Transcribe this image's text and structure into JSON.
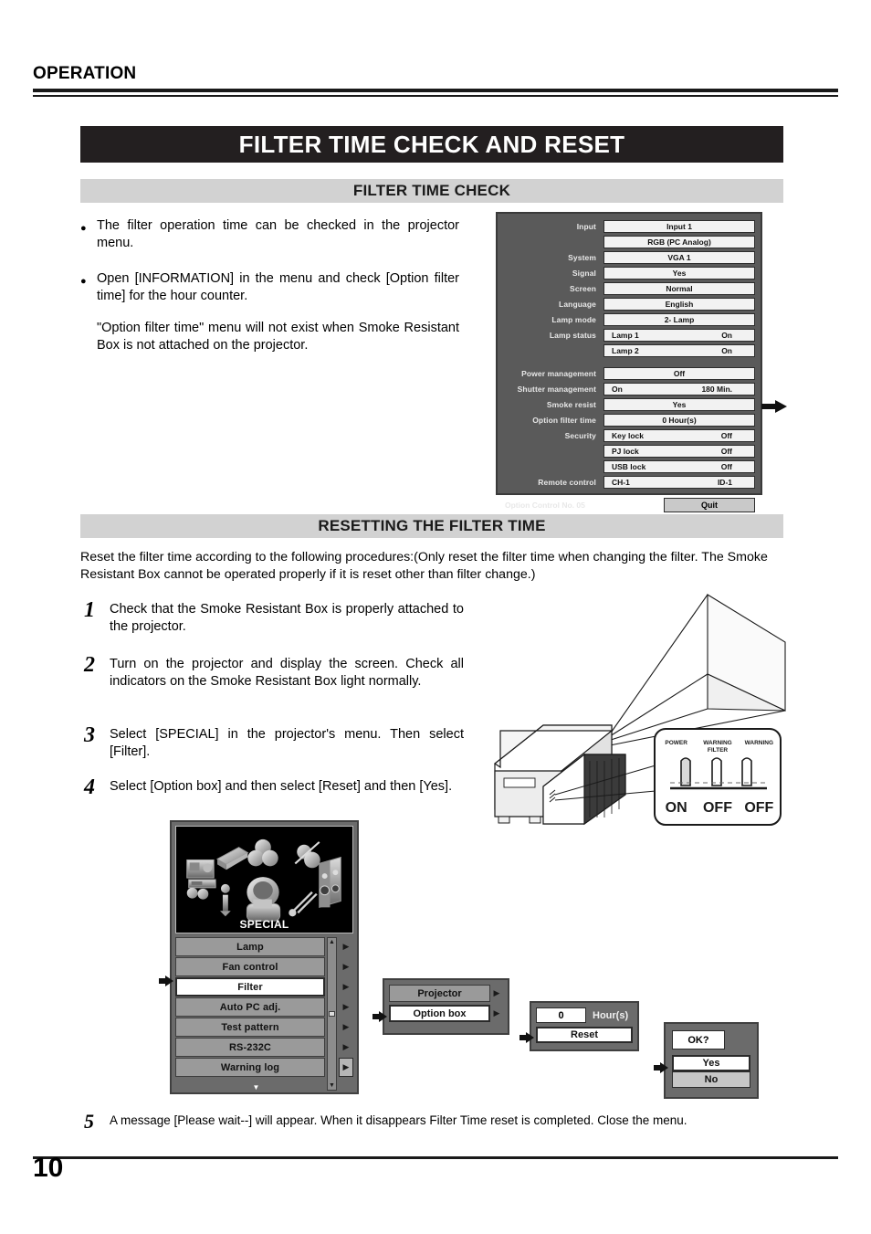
{
  "running_head": "OPERATION",
  "banner_title": "FILTER TIME CHECK AND RESET",
  "sections": {
    "check": {
      "band": "FILTER TIME CHECK",
      "bullets": [
        "The filter operation time can be checked in the projector menu.",
        "Open [INFORMATION] in the menu and check [Option filter  time] for the hour counter."
      ],
      "note": "\"Option filter time\" menu will not exist when Smoke Resistant Box is not attached on the projector."
    },
    "reset": {
      "band": "RESETTING THE FILTER TIME",
      "intro": "Reset the filter time according to the following procedures:(Only reset the filter time when changing the filter. The Smoke Resistant Box cannot be operated properly if it is reset other than filter change.)",
      "steps": [
        {
          "num": "1",
          "text": "Check that the Smoke Resistant Box is properly attached to the projector."
        },
        {
          "num": "2",
          "text": "Turn on the projector and display the screen. Check all indicators on the Smoke Resistant Box light normally."
        },
        {
          "num": "3",
          "text": "Select [SPECIAL] in the projector's menu. Then select [Filter]."
        },
        {
          "num": "4",
          "text": "Select [Option box] and then select [Reset] and then [Yes]."
        },
        {
          "num": "5",
          "text": "A message [Please wait--] will appear. When it disappears Filter Time reset is completed. Close the menu."
        }
      ]
    }
  },
  "osd_information": {
    "rows": [
      {
        "label": "Input",
        "value": "Input 1"
      },
      {
        "label": "",
        "value": "RGB (PC Analog)"
      },
      {
        "label": "System",
        "value": "VGA 1"
      },
      {
        "label": "Signal",
        "value": "Yes"
      },
      {
        "label": "Screen",
        "value": "Normal"
      },
      {
        "label": "Language",
        "value": "English"
      },
      {
        "label": "Lamp mode",
        "value": "2- Lamp"
      },
      {
        "label": "Lamp status",
        "value": "Lamp 1",
        "value2": "On"
      },
      {
        "label": "",
        "value": "Lamp 2",
        "value2": "On"
      }
    ],
    "rows2": [
      {
        "label": "Power management",
        "value": "Off"
      },
      {
        "label": "Shutter management",
        "value": "On",
        "value2": "180 Min."
      },
      {
        "label": "Smoke resist",
        "value": "Yes"
      },
      {
        "label": "Option filter time",
        "value": "0 Hour(s)",
        "highlighted": true
      },
      {
        "label": "Security",
        "value": "Key lock",
        "value2": "Off"
      },
      {
        "label": "",
        "value": "PJ lock",
        "value2": "Off"
      },
      {
        "label": "",
        "value": "USB lock",
        "value2": "Off"
      },
      {
        "label": "Remote control",
        "value": "CH-1",
        "value2": "ID-1"
      }
    ],
    "footer_label": "Option Control No. 05",
    "quit_label": "Quit"
  },
  "special_menu": {
    "title": "SPECIAL",
    "items": [
      {
        "label": "Lamp",
        "selected": false
      },
      {
        "label": "Fan control",
        "selected": false
      },
      {
        "label": "Filter",
        "selected": true
      },
      {
        "label": "Auto PC adj.",
        "selected": false
      },
      {
        "label": "Test pattern",
        "selected": false
      },
      {
        "label": "RS-232C",
        "selected": false
      },
      {
        "label": "Warning log",
        "selected": false
      }
    ]
  },
  "filter_submenu": {
    "items": [
      {
        "label": "Projector",
        "selected": false
      },
      {
        "label": "Option box",
        "selected": true
      }
    ]
  },
  "reset_dialog": {
    "hours_value": "0",
    "hours_unit": "Hour(s)",
    "reset_label": "Reset"
  },
  "confirm_dialog": {
    "prompt": "OK?",
    "yes_label": "Yes",
    "no_label": "No"
  },
  "indicator_panel": {
    "labels": [
      "POWER",
      "WARNING\nFILTER",
      "WARNING"
    ],
    "label_power": "POWER",
    "label_warning_filter_1": "WARNING",
    "label_warning_filter_2": "FILTER",
    "label_warning": "WARNING",
    "states": [
      "ON",
      "OFF",
      "OFF"
    ],
    "state_power": "ON",
    "state_filter": "OFF",
    "state_warning": "OFF"
  },
  "page_number": "10",
  "colors": {
    "banner_bg": "#231f20",
    "band_bg": "#d2d2d2",
    "osd_bg": "#5a5a5a",
    "osd_field": "#f2f2f2",
    "menu_bg": "#6b6b6b",
    "menu_item": "#9a9a9a"
  }
}
